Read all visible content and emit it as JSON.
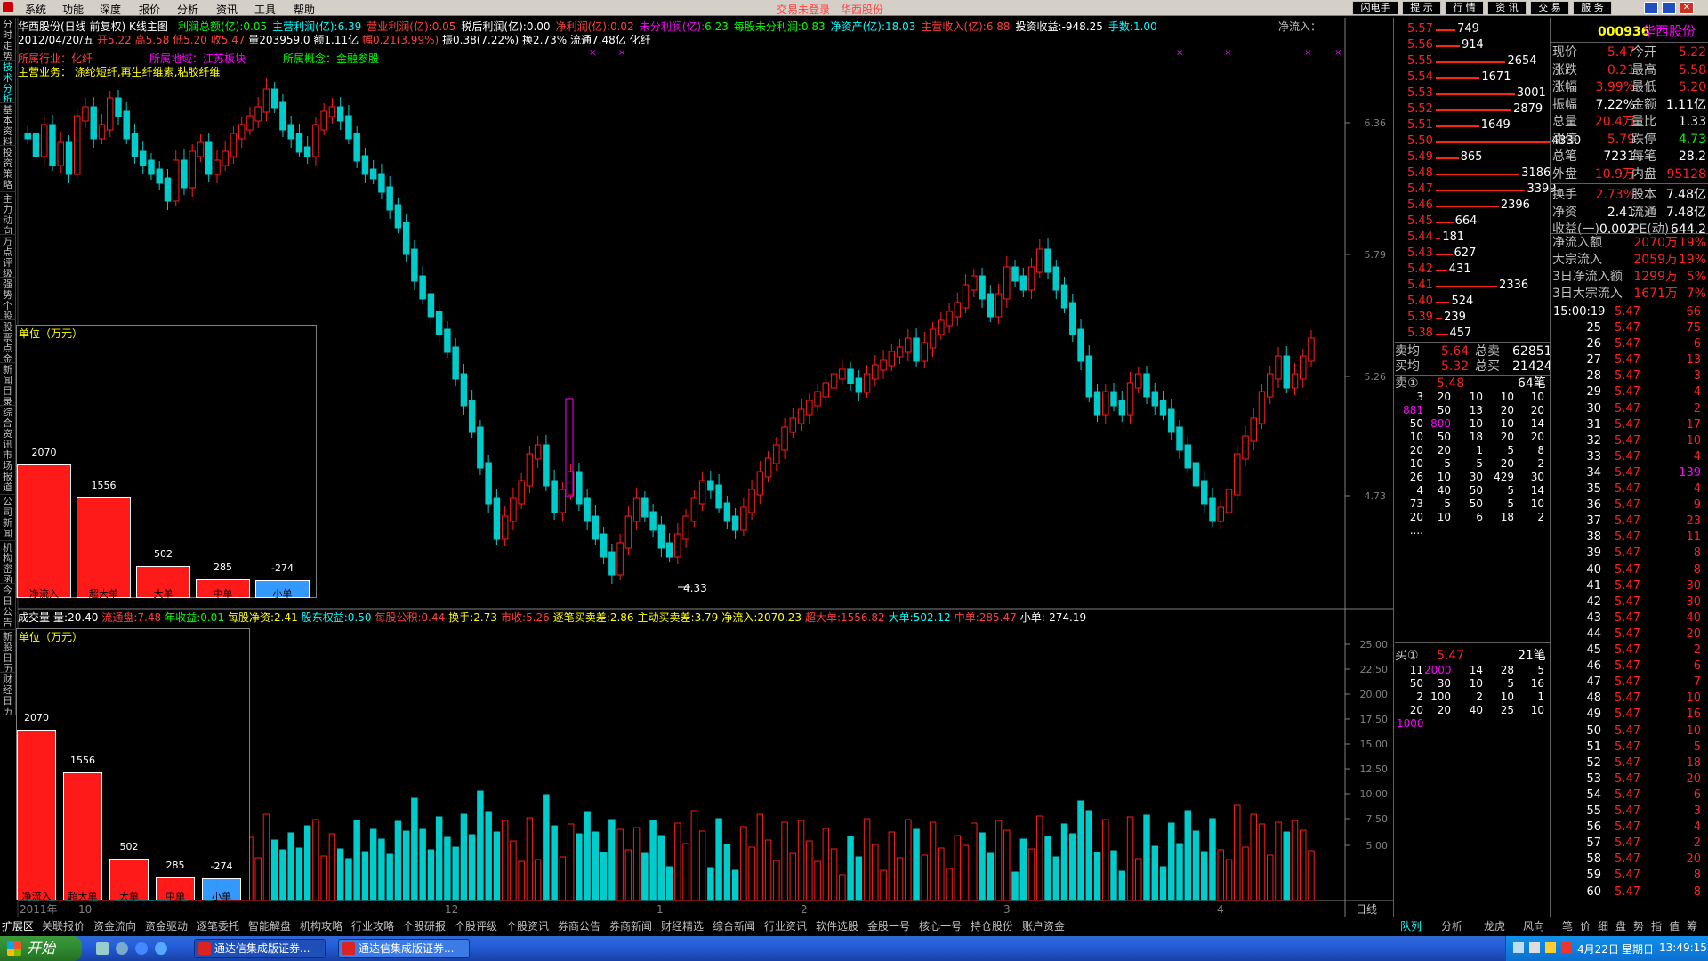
{
  "menu": [
    "系统",
    "功能",
    "深度",
    "报价",
    "分析",
    "资讯",
    "工具",
    "帮助"
  ],
  "top_center": {
    "left": "交易未登录",
    "right": "华西股份"
  },
  "top_buttons": [
    "闪电手",
    "提 示",
    "行 情",
    "资 讯",
    "交 易",
    "服 务"
  ],
  "side_tabs": [
    "分时走势",
    "技术分析",
    "基本资料",
    "投资策略",
    "主力动向",
    "万点评级",
    "强势个股",
    "股票点金",
    "新闻目录",
    "综合资讯",
    "市场报道",
    "公司新闻",
    "机构密函",
    "今日公告",
    "新股日历",
    "财经日历"
  ],
  "chart_header": {
    "title": "华西股份(日线 前复权) K线主图",
    "date_line": "2012/04/20/五",
    "open": "开5.22",
    "high": "高5.58",
    "low": "低5.20",
    "close": "收5.47",
    "vol": "量203959.0",
    "amount": "额1.11亿",
    "change": "幅0.21(3.99%)",
    "amplitude": "振0.38(7.22%)",
    "turnover": "换2.73%",
    "float": "流通7.48亿",
    "concept": "化纤"
  },
  "fin_row": [
    {
      "k": "利润总额(亿):",
      "v": "0.05"
    },
    {
      "k": "主营利润(亿):",
      "v": "6.39"
    },
    {
      "k": "营业利润(亿):",
      "v": "0.05"
    },
    {
      "k": "税后利润(亿):",
      "v": "0.00"
    },
    {
      "k": "净利润(亿):",
      "v": "0.02"
    },
    {
      "k": "未分利润(亿):",
      "v": "6.23"
    },
    {
      "k": "每股未分利润:",
      "v": "0.83"
    },
    {
      "k": "净资产(亿):",
      "v": "18.03"
    },
    {
      "k": "主营收入(亿):",
      "v": "6.88"
    },
    {
      "k": "投资收益:",
      "v": "-948.25"
    },
    {
      "k": "手数:",
      "v": "1.00"
    }
  ],
  "net_inflow_label": "净流入：",
  "tags": {
    "industry": "所属行业：化纤",
    "region": "所属地域：江苏板块",
    "concept": "所属概念：金融参股",
    "business": "主营业务：  涤纶短纤,再生纤维素,粘胶纤维"
  },
  "price_axis": [
    "6.36",
    "5.79",
    "5.26",
    "4.73"
  ],
  "low_label": "4.33",
  "vol_axis": [
    "25.00",
    "22.50",
    "20.00",
    "17.50",
    "15.00",
    "12.50",
    "10.00",
    "7.50",
    "5.00"
  ],
  "vol_header": [
    {
      "k": "成交量",
      "v": ""
    },
    {
      "k": "量:",
      "v": "20.40"
    },
    {
      "k": "流通盘:",
      "v": "7.48"
    },
    {
      "k": "年收益:",
      "v": "0.01"
    },
    {
      "k": "每股净资:",
      "v": "2.41"
    },
    {
      "k": "股东权益:",
      "v": "0.50"
    },
    {
      "k": "每股公积:",
      "v": "0.44"
    },
    {
      "k": "换手:",
      "v": "2.73"
    },
    {
      "k": "市收:",
      "v": "5.26"
    },
    {
      "k": "逐笔买卖差:",
      "v": "2.86"
    },
    {
      "k": "主动买卖差:",
      "v": "3.79"
    },
    {
      "k": "净流入:",
      "v": "2070.23"
    },
    {
      "k": "超大单:",
      "v": "1556.82"
    },
    {
      "k": "大单:",
      "v": "502.12"
    },
    {
      "k": "中单:",
      "v": "285.47"
    },
    {
      "k": "小单:",
      "v": "-274.19"
    }
  ],
  "flow_panel": {
    "unit": "单位（万元）",
    "bars": [
      {
        "cat": "净流入",
        "v": 2070,
        "label": "2070",
        "color": "#ff1a1a"
      },
      {
        "cat": "超大单",
        "v": 1556,
        "label": "1556",
        "color": "#ff1a1a"
      },
      {
        "cat": "大单",
        "v": 502,
        "label": "502",
        "color": "#ff1a1a"
      },
      {
        "cat": "中单",
        "v": 285,
        "label": "285",
        "color": "#ff1a1a"
      },
      {
        "cat": "小单",
        "v": -274,
        "label": "-274",
        "color": "#3399ff"
      }
    ]
  },
  "x_axis": [
    "2011年",
    "10",
    "12",
    "1",
    "2",
    "3",
    "4"
  ],
  "x_axis_right": "日线",
  "sell_orders": [
    {
      "p": "5.57",
      "q": "749"
    },
    {
      "p": "5.56",
      "q": "914"
    },
    {
      "p": "5.55",
      "q": "2654"
    },
    {
      "p": "5.54",
      "q": "1671"
    },
    {
      "p": "5.53",
      "q": "3001"
    },
    {
      "p": "5.52",
      "q": "2879"
    },
    {
      "p": "5.51",
      "q": "1649"
    },
    {
      "p": "5.50",
      "q": "4330"
    },
    {
      "p": "5.49",
      "q": "865"
    },
    {
      "p": "5.48",
      "q": "3186"
    },
    {
      "p": "5.47",
      "q": "3399"
    },
    {
      "p": "5.46",
      "q": "2396"
    },
    {
      "p": "5.45",
      "q": "664"
    },
    {
      "p": "5.44",
      "q": "181"
    },
    {
      "p": "5.43",
      "q": "627"
    },
    {
      "p": "5.42",
      "q": "431"
    },
    {
      "p": "5.41",
      "q": "2336"
    },
    {
      "p": "5.40",
      "q": "524"
    },
    {
      "p": "5.39",
      "q": "239"
    },
    {
      "p": "5.38",
      "q": "457"
    }
  ],
  "avg": {
    "sell_avg_k": "卖均",
    "sell_avg_v": "5.64",
    "total_sell_k": "总卖",
    "total_sell_v": "62851",
    "buy_avg_k": "买均",
    "buy_avg_v": "5.32",
    "total_buy_k": "总买",
    "total_buy_v": "21424"
  },
  "sell1": {
    "k": "卖①",
    "p": "5.48",
    "n": "64笔"
  },
  "sell_queue": [
    [
      "3",
      "20",
      "10",
      "10",
      "10"
    ],
    [
      "881",
      "50",
      "13",
      "20",
      "20"
    ],
    [
      "50",
      "800",
      "10",
      "10",
      "14"
    ],
    [
      "10",
      "50",
      "18",
      "20",
      "20"
    ],
    [
      "20",
      "20",
      "1",
      "5",
      "8"
    ],
    [
      "10",
      "5",
      "5",
      "20",
      "2"
    ],
    [
      "26",
      "10",
      "30",
      "429",
      "30"
    ],
    [
      "4",
      "40",
      "50",
      "5",
      "14"
    ],
    [
      "73",
      "5",
      "50",
      "5",
      "10"
    ],
    [
      "20",
      "10",
      "6",
      "18",
      "2"
    ],
    [
      "....",
      "",
      "",
      "",
      ""
    ]
  ],
  "buy1": {
    "k": "买①",
    "p": "5.47",
    "n": "21笔"
  },
  "buy_queue": [
    [
      "11",
      "2000",
      "14",
      "28",
      "5"
    ],
    [
      "50",
      "30",
      "10",
      "5",
      "16"
    ],
    [
      "2",
      "100",
      "2",
      "10",
      "1"
    ],
    [
      "20",
      "20",
      "40",
      "25",
      "10"
    ],
    [
      "1000",
      "",
      "",
      "",
      ""
    ]
  ],
  "quote": {
    "code": "000936",
    "name": "华西股份",
    "rows": [
      [
        "现价",
        "5.47",
        "今开",
        "5.22"
      ],
      [
        "涨跌",
        "0.21",
        "最高",
        "5.58"
      ],
      [
        "涨幅",
        "3.99%",
        "最低",
        "5.20"
      ],
      [
        "振幅",
        "7.22%",
        "金额",
        "1.11亿"
      ],
      [
        "总量",
        "20.4万",
        "量比",
        "1.33"
      ],
      [
        "涨停",
        "5.79",
        "跌停",
        "4.73"
      ],
      [
        "总笔",
        "7231",
        "每笔",
        "28.2"
      ],
      [
        "外盘",
        "10.9万",
        "内盘",
        "95128"
      ],
      [
        "换手",
        "2.73%",
        "股本",
        "7.48亿"
      ],
      [
        "净资",
        "2.41",
        "流通",
        "7.48亿"
      ],
      [
        "收益(一)",
        "0.002",
        "PE(动)",
        "644.2"
      ]
    ],
    "flow_rows": [
      [
        "净流入额",
        "2070万",
        "19%"
      ],
      [
        "大宗流入",
        "2059万",
        "19%"
      ],
      [
        "3日净流入额",
        "1299万",
        "5%"
      ],
      [
        "3日大宗流入",
        "1671万",
        "7%"
      ]
    ]
  },
  "ticks": {
    "time": "15:00:19",
    "price": "5.47",
    "first_vol": "66",
    "rows": [
      [
        "25",
        "5.47",
        "75"
      ],
      [
        "26",
        "5.47",
        "6"
      ],
      [
        "27",
        "5.47",
        "13"
      ],
      [
        "28",
        "5.47",
        "3"
      ],
      [
        "29",
        "5.47",
        "4"
      ],
      [
        "30",
        "5.47",
        "2"
      ],
      [
        "31",
        "5.47",
        "17"
      ],
      [
        "32",
        "5.47",
        "10"
      ],
      [
        "33",
        "5.47",
        "4"
      ],
      [
        "34",
        "5.47",
        "139"
      ],
      [
        "35",
        "5.47",
        "4"
      ],
      [
        "36",
        "5.47",
        "9"
      ],
      [
        "37",
        "5.47",
        "23"
      ],
      [
        "38",
        "5.47",
        "11"
      ],
      [
        "39",
        "5.47",
        "8"
      ],
      [
        "40",
        "5.47",
        "8"
      ],
      [
        "41",
        "5.47",
        "30"
      ],
      [
        "42",
        "5.47",
        "30"
      ],
      [
        "43",
        "5.47",
        "40"
      ],
      [
        "44",
        "5.47",
        "20"
      ],
      [
        "45",
        "5.47",
        "2"
      ],
      [
        "46",
        "5.47",
        "6"
      ],
      [
        "47",
        "5.47",
        "7"
      ],
      [
        "48",
        "5.47",
        "10"
      ],
      [
        "49",
        "5.47",
        "16"
      ],
      [
        "50",
        "5.47",
        "10"
      ],
      [
        "51",
        "5.47",
        "5"
      ],
      [
        "52",
        "5.47",
        "18"
      ],
      [
        "53",
        "5.47",
        "20"
      ],
      [
        "54",
        "5.47",
        "6"
      ],
      [
        "55",
        "5.47",
        "3"
      ],
      [
        "56",
        "5.47",
        "4"
      ],
      [
        "57",
        "5.47",
        "2"
      ],
      [
        "58",
        "5.47",
        "20"
      ],
      [
        "59",
        "5.47",
        "8"
      ],
      [
        "60",
        "5.47",
        "8"
      ]
    ]
  },
  "bottom_tabs": [
    "扩展区",
    "关联报价",
    "资金流向",
    "资金驱动",
    "逐笔委托",
    "智能解盘",
    "机构攻略",
    "行业攻略",
    "个股研报",
    "个股评级",
    "个股资讯",
    "券商公告",
    "券商新闻",
    "财经精选",
    "综合新闻",
    "行业资讯",
    "软件选股",
    "金股一号",
    "核心一号",
    "持仓股份",
    "账户资金"
  ],
  "right_bottom_tabs": [
    "队列",
    "分析",
    "龙虎",
    "风向",
    "笔",
    "价",
    "细",
    "盘",
    "势",
    "指",
    "值",
    "筹"
  ],
  "taskbar": {
    "start": "开始",
    "apps": [
      "通达信集成版证券...",
      "通达信集成版证券..."
    ],
    "date": "4月22日",
    "weekday": "星期日",
    "time": "13:49:15"
  },
  "colors": {
    "up": "#ff1a1a",
    "down": "#00cccc",
    "yellow": "#ffff00",
    "cyan": "#00ffff",
    "magenta": "#ff00ff"
  }
}
